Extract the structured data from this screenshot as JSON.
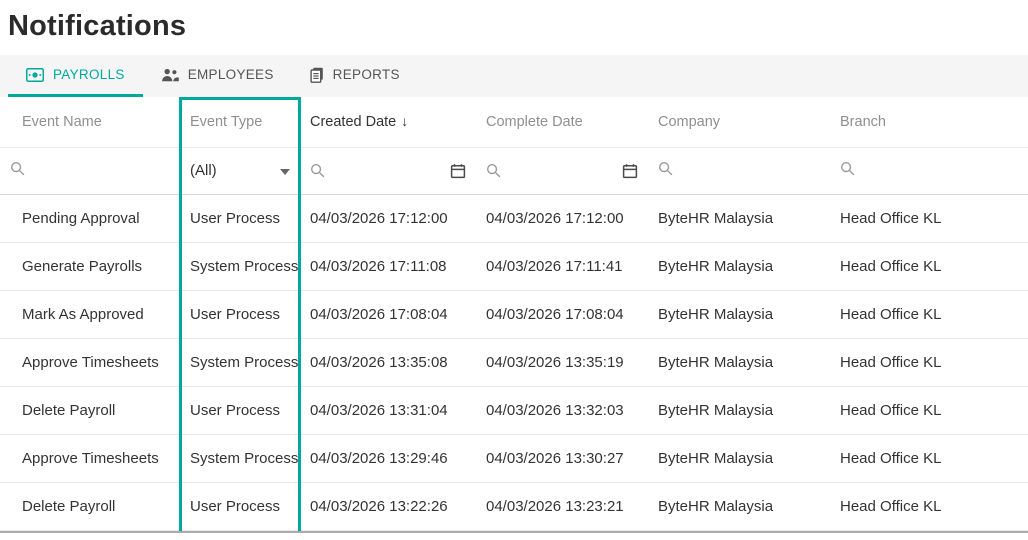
{
  "colors": {
    "accent": "#00a99d"
  },
  "page": {
    "title": "Notifications"
  },
  "tabs": [
    {
      "label": "PAYROLLS",
      "icon": "payrolls-icon",
      "active": true
    },
    {
      "label": "EMPLOYEES",
      "icon": "employees-icon",
      "active": false
    },
    {
      "label": "REPORTS",
      "icon": "reports-icon",
      "active": false
    }
  ],
  "table": {
    "columns": [
      {
        "id": "event_name",
        "label": "Event Name",
        "filter": "search"
      },
      {
        "id": "event_type",
        "label": "Event Type",
        "filter": "select",
        "filter_value": "(All)",
        "highlighted": true
      },
      {
        "id": "created_date",
        "label": "Created Date",
        "filter": "search+calendar",
        "sort": "desc",
        "sort_indicator": "↓"
      },
      {
        "id": "complete_date",
        "label": "Complete Date",
        "filter": "search+calendar"
      },
      {
        "id": "company",
        "label": "Company",
        "filter": "search"
      },
      {
        "id": "branch",
        "label": "Branch",
        "filter": "search"
      }
    ],
    "rows": [
      [
        "Pending Approval",
        "User Process",
        "04/03/2026 17:12:00",
        "04/03/2026 17:12:00",
        "ByteHR Malaysia",
        "Head Office KL"
      ],
      [
        "Generate Payrolls",
        "System Process",
        "04/03/2026 17:11:08",
        "04/03/2026 17:11:41",
        "ByteHR Malaysia",
        "Head Office KL"
      ],
      [
        "Mark As Approved",
        "User Process",
        "04/03/2026 17:08:04",
        "04/03/2026 17:08:04",
        "ByteHR Malaysia",
        "Head Office KL"
      ],
      [
        "Approve Timesheets",
        "System Process",
        "04/03/2026 13:35:08",
        "04/03/2026 13:35:19",
        "ByteHR Malaysia",
        "Head Office KL"
      ],
      [
        "Delete Payroll",
        "User Process",
        "04/03/2026 13:31:04",
        "04/03/2026 13:32:03",
        "ByteHR Malaysia",
        "Head Office KL"
      ],
      [
        "Approve Timesheets",
        "System Process",
        "04/03/2026 13:29:46",
        "04/03/2026 13:30:27",
        "ByteHR Malaysia",
        "Head Office KL"
      ],
      [
        "Delete Payroll",
        "User Process",
        "04/03/2026 13:22:26",
        "04/03/2026 13:23:21",
        "ByteHR Malaysia",
        "Head Office KL"
      ]
    ]
  }
}
